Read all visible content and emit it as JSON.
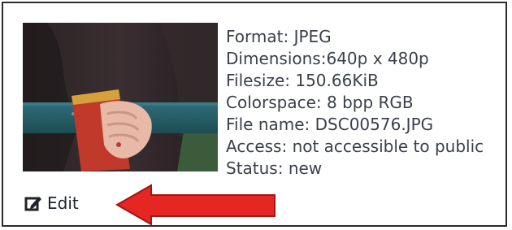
{
  "image": {
    "icon": "painting-thumbnail"
  },
  "metadata": {
    "lines": [
      "Format: JPEG",
      "Dimensions:640p x 480p",
      "Filesize: 150.66KiB",
      "Colorspace: 8 bpp RGB",
      "File name: DSC00576.JPG",
      "Access: not accessible to public",
      "Status: new"
    ]
  },
  "edit": {
    "label": "Edit",
    "icon": "edit-icon"
  },
  "annotation": {
    "icon": "red-arrow-icon",
    "color": "#e52622"
  }
}
